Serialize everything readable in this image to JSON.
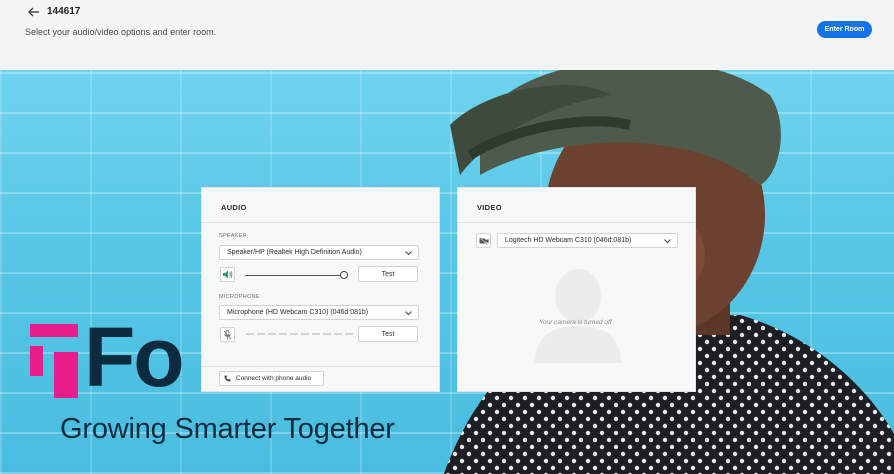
{
  "header": {
    "room_id": "144617",
    "subtitle": "Select your audio/video options and enter room.",
    "enter_label": "Enter Room"
  },
  "brand": {
    "word": "Fo",
    "tagline": "Growing Smarter Together",
    "colors": {
      "magenta": "#e91e8c",
      "navy": "#0d2b3e"
    }
  },
  "audio": {
    "title": "AUDIO",
    "speaker_label": "SPEAKER",
    "speaker_value": "Speaker/HP (Realtek High Definition Audio)",
    "speaker_volume_fraction": 1.0,
    "speaker_test": "Test",
    "mic_label": "MICROPHONE",
    "mic_value": "Microphone (HD Webcam C310) (046d:081b)",
    "mic_test": "Test",
    "phone_label": "Connect with phone audio"
  },
  "video": {
    "title": "VIDEO",
    "camera_value": "Logitech HD Webcam C310 (046d:081b)",
    "camera_off_text": "Your camera is turned off"
  },
  "icons": {
    "back": "arrow-left-icon",
    "speaker": "speaker-volume-icon",
    "mic": "mic-muted-icon",
    "phone": "phone-icon",
    "camera": "camera-off-icon",
    "chevron": "chevron-down-icon"
  },
  "colors": {
    "accent": "#1473e6",
    "speaker_icon": "#2d9d78",
    "wall": "#56c6e6"
  }
}
